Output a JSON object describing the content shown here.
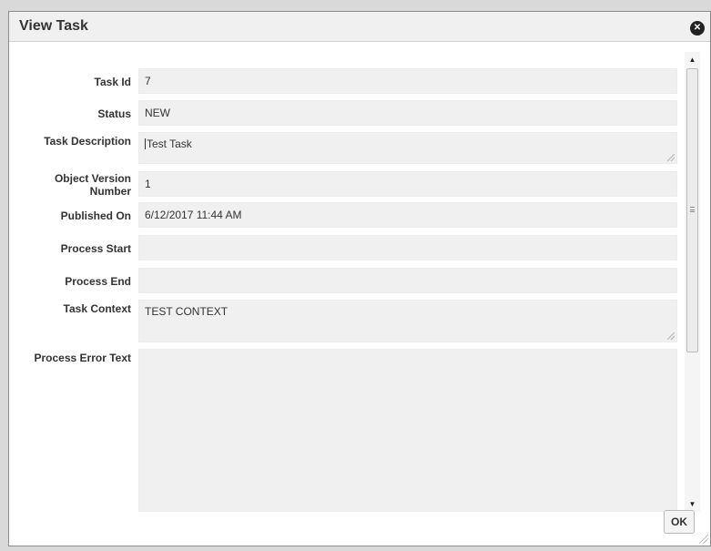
{
  "dialog": {
    "title": "View Task",
    "close_icon": "close-circle-icon",
    "ok_label": "OK"
  },
  "fields": {
    "task_id": {
      "label": "Task Id",
      "value": "7"
    },
    "status": {
      "label": "Status",
      "value": "NEW"
    },
    "task_description": {
      "label": "Task Description",
      "value": "Test Task"
    },
    "object_version_number": {
      "label_line1": "Object Version",
      "label_line2": "Number",
      "value": "1"
    },
    "published_on": {
      "label": "Published On",
      "value": "6/12/2017 11:44 AM"
    },
    "process_start": {
      "label": "Process Start",
      "value": ""
    },
    "process_end": {
      "label": "Process End",
      "value": ""
    },
    "task_context": {
      "label": "Task Context",
      "value": "TEST CONTEXT"
    },
    "process_error_text": {
      "label": "Process Error Text",
      "value": ""
    }
  },
  "scrollbar": {
    "up_icon": "arrow-up-icon",
    "down_icon": "arrow-down-icon"
  }
}
